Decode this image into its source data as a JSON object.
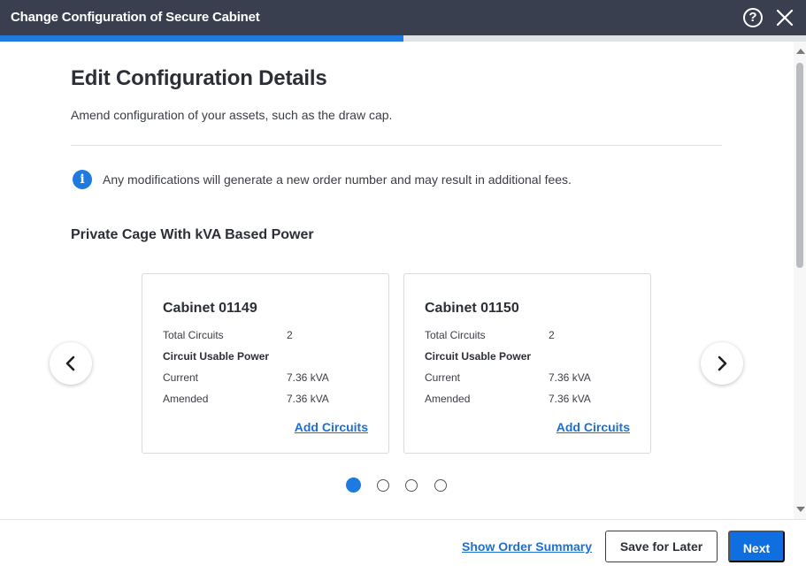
{
  "window": {
    "title": "Change Configuration of Secure Cabinet",
    "help_icon": "question-circle-icon",
    "help_glyph": "?",
    "close_icon": "close-icon"
  },
  "progress": {
    "percent": 50,
    "color": "#1f7ae0"
  },
  "header": {
    "title": "Edit Configuration Details",
    "subtitle": "Amend configuration of your assets, such as the draw cap."
  },
  "notice": {
    "icon": "info-icon",
    "glyph": "i",
    "text": "Any modifications will generate a new order number and may result in additional fees."
  },
  "section": {
    "title": "Private Cage With kVA Based Power"
  },
  "carousel": {
    "prev_icon": "chevron-left-icon",
    "next_icon": "chevron-right-icon",
    "active_page": 1,
    "page_count": 4,
    "cards": [
      {
        "title": "Cabinet 01149",
        "total_circuits_label": "Total Circuits",
        "total_circuits_value": "2",
        "power_label": "Circuit Usable Power",
        "current_label": "Current",
        "current_value": "7.36 kVA",
        "amended_label": "Amended",
        "amended_value": "7.36 kVA",
        "action_label": "Add Circuits"
      },
      {
        "title": "Cabinet 01150",
        "total_circuits_label": "Total Circuits",
        "total_circuits_value": "2",
        "power_label": "Circuit Usable Power",
        "current_label": "Current",
        "current_value": "7.36 kVA",
        "amended_label": "Amended",
        "amended_value": "7.36 kVA",
        "action_label": "Add Circuits"
      }
    ]
  },
  "footer": {
    "summary_link": "Show Order Summary",
    "save_label": "Save for Later",
    "next_label": "Next"
  },
  "colors": {
    "titlebar": "#3a3f4f",
    "accent": "#1f7ae0",
    "link": "#1f6fd1"
  }
}
